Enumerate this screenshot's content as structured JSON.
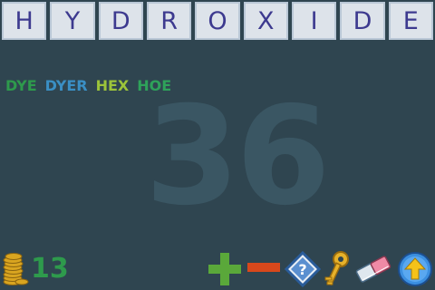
{
  "tiles": [
    "H",
    "Y",
    "D",
    "R",
    "O",
    "X",
    "I",
    "D",
    "E"
  ],
  "found_words": [
    {
      "text": "DYE",
      "color": "#2e9a4c"
    },
    {
      "text": "DYER",
      "color": "#3a8fc4"
    },
    {
      "text": "HEX",
      "color": "#9cc43a"
    },
    {
      "text": "HOE",
      "color": "#2ea25a"
    }
  ],
  "score": "36",
  "coins": "13",
  "toolbar": {
    "add_icon": "plus-icon",
    "remove_icon": "minus-icon",
    "hint_icon": "question-diamond-icon",
    "key_icon": "key-icon",
    "eraser_icon": "eraser-icon",
    "submit_icon": "up-arrow-icon"
  },
  "colors": {
    "background": "#2f4550",
    "tile_bg": "#dde3ea",
    "tile_text": "#3d3a8f",
    "coin_text": "#2e9a4c",
    "score_watermark": "#3a5663"
  }
}
